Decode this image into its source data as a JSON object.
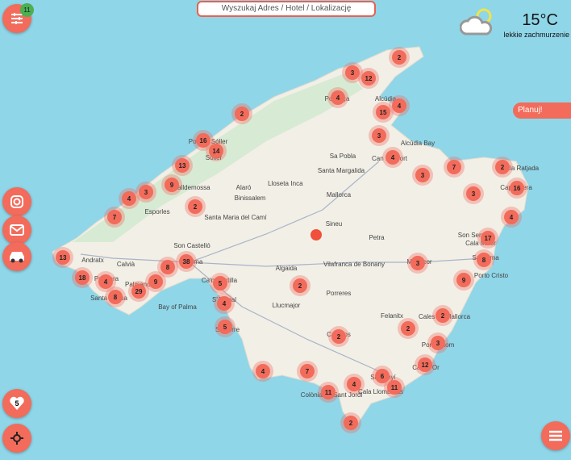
{
  "search": {
    "placeholder": "Wyszukaj Adres / Hotel / Lokalizację"
  },
  "filter": {
    "icon": "sliders-icon",
    "badge": "11"
  },
  "weather": {
    "temperature": "15°C",
    "description": "lekkie zachmurzenie",
    "icon": "partly-cloudy-icon"
  },
  "plan_button": "Planuj!",
  "favorites": {
    "count": "5",
    "icon": "heart-icon"
  },
  "side_buttons": [
    {
      "icon": "instagram-icon"
    },
    {
      "icon": "mail-icon"
    },
    {
      "icon": "car-icon"
    }
  ],
  "colors": {
    "accent": "#f26b5b",
    "sea": "#8fd6e8",
    "land": "#f2efe6",
    "badge": "#4caf50"
  },
  "clusters": [
    "2",
    "3",
    "12",
    "4",
    "4",
    "15",
    "2",
    "3",
    "16",
    "14",
    "4",
    "13",
    "7",
    "2",
    "3",
    "9",
    "3",
    "4",
    "16",
    "3",
    "2",
    "7",
    "4",
    "17",
    "13",
    "38",
    "8",
    "8",
    "3",
    "18",
    "4",
    "9",
    "5",
    "2",
    "9",
    "29",
    "8",
    "4",
    "2",
    "2",
    "5",
    "2",
    "3",
    "12",
    "4",
    "7",
    "6",
    "4",
    "11",
    "11",
    "2"
  ],
  "towns": [
    "Pollença",
    "Alcúdia",
    "Port de Sóller",
    "Sóller",
    "Valldemossa",
    "Esporles",
    "Alaró",
    "Binissalem",
    "Lloseta",
    "Inca",
    "Sa Pobla",
    "Santa Margalida",
    "Mallorca",
    "Can Picafort",
    "Santa Maria del Camí",
    "Sineu",
    "Petra",
    "Son Castelló",
    "Palma",
    "Calvià",
    "Andratx",
    "Algaida",
    "Vilafranca de Bonany",
    "Manacor",
    "Son Servera",
    "Cala Millor",
    "Sa Coma",
    "Porto Cristo",
    "Cala Ratjada",
    "Capdepera",
    "Peguera",
    "Santa Ponsa",
    "Palmanova",
    "Bay of Palma",
    "Ca'n Pastilla",
    "S'Arenal",
    "Llucmajor",
    "Porreres",
    "Felanitx",
    "Cales de Mallorca",
    "Portocolom",
    "Cala d'Or",
    "Campos",
    "Santanyí",
    "Colònia de Sant Jordi",
    "Cala Llombards",
    "Sa Torre",
    "Alcúdia Bay"
  ]
}
